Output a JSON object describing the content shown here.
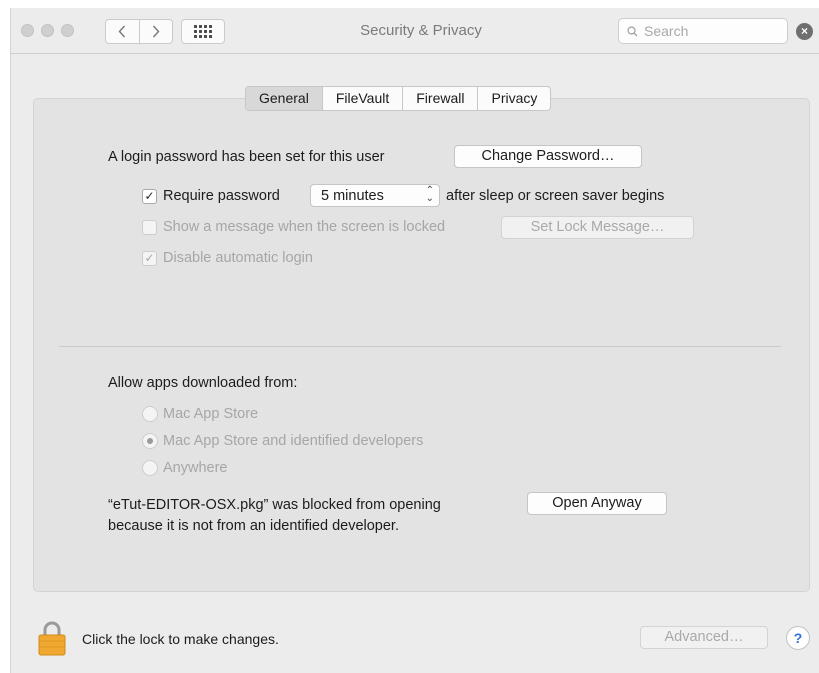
{
  "window": {
    "title": "Security & Privacy",
    "search_placeholder": "Search",
    "back_icon": "chevron-left-icon",
    "forward_icon": "chevron-right-icon",
    "show_all_icon": "grid-icon",
    "clear_icon": "clear-search-icon"
  },
  "tabs": [
    {
      "label": "General",
      "active": true
    },
    {
      "label": "FileVault",
      "active": false
    },
    {
      "label": "Firewall",
      "active": false
    },
    {
      "label": "Privacy",
      "active": false
    }
  ],
  "general": {
    "login_password_text": "A login password has been set for this user",
    "change_password_label": "Change Password…",
    "require_password": {
      "checked": true,
      "label": "Require password",
      "delay_value": "5 minutes",
      "suffix": "after sleep or screen saver begins"
    },
    "show_message": {
      "checked": false,
      "enabled": false,
      "label": "Show a message when the screen is locked",
      "button_label": "Set Lock Message…"
    },
    "disable_auto_login": {
      "checked": true,
      "enabled": false,
      "label": "Disable automatic login"
    }
  },
  "gatekeeper": {
    "heading": "Allow apps downloaded from:",
    "options": [
      {
        "label": "Mac App Store",
        "selected": false
      },
      {
        "label": "Mac App Store and identified developers",
        "selected": true
      },
      {
        "label": "Anywhere",
        "selected": false
      }
    ],
    "blocked_line1": "“eTut-EDITOR-OSX.pkg” was blocked from opening",
    "blocked_line2": "because it is not from an identified developer.",
    "open_anyway_label": "Open Anyway"
  },
  "footer": {
    "lock_text": "Click the lock to make changes.",
    "advanced_label": "Advanced…",
    "help_label": "?"
  },
  "colors": {
    "window_bg": "#ececec",
    "panel_bg": "#e3e3e3",
    "lock_gold": "#f0a830",
    "help_blue": "#2f6ee0"
  }
}
